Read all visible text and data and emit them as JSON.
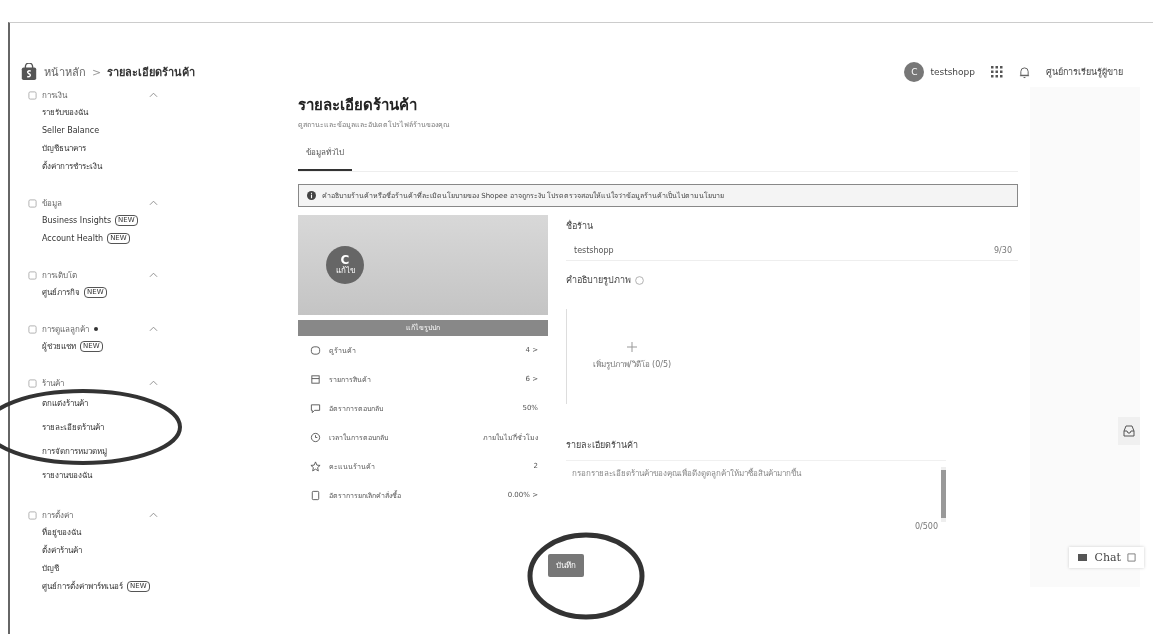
{
  "breadcrumb": {
    "home": "หน้าหลัก",
    "separator": ">",
    "current": "รายละเอียดร้านค้า"
  },
  "header": {
    "avatar_letter": "C",
    "username": "testshopp",
    "learning_link": "ศูนย์การเรียนรู้ผู้ขาย"
  },
  "sidebar": [
    {
      "title": "การเงิน",
      "expanded": true,
      "dot": false,
      "items": [
        {
          "label": "รายรับของฉัน"
        },
        {
          "label": "Seller Balance"
        },
        {
          "label": "บัญชีธนาคาร"
        },
        {
          "label": "ตั้งค่าการชำระเงิน"
        }
      ]
    },
    {
      "title": "ข้อมูล",
      "expanded": true,
      "dot": false,
      "items": [
        {
          "label": "Business Insights",
          "badge": "NEW"
        },
        {
          "label": "Account Health",
          "badge": "NEW"
        }
      ]
    },
    {
      "title": "การเติบโต",
      "expanded": true,
      "dot": false,
      "items": [
        {
          "label": "ศูนย์ภารกิจ",
          "badge": "NEW"
        }
      ]
    },
    {
      "title": "การดูแลลูกค้า",
      "expanded": true,
      "dot": true,
      "items": [
        {
          "label": "ผู้ช่วยแชท",
          "badge": "NEW"
        }
      ]
    },
    {
      "title": "ร้านค้า",
      "expanded": true,
      "dot": false,
      "circled": true,
      "items": [
        {
          "label": "ตกแต่งร้านค้า"
        },
        {
          "label": "รายละเอียดร้านค้า"
        },
        {
          "label": "การจัดการหมวดหมู่"
        },
        {
          "label": "รายงานของฉัน"
        }
      ]
    },
    {
      "title": "การตั้งค่า",
      "expanded": true,
      "dot": false,
      "items": [
        {
          "label": "ที่อยู่ของฉัน"
        },
        {
          "label": "ตั้งค่าร้านค้า"
        },
        {
          "label": "บัญชี"
        },
        {
          "label": "ศูนย์การตั้งค่าพาร์ทเนอร์",
          "badge": "NEW"
        }
      ]
    }
  ],
  "page": {
    "title": "รายละเอียดร้านค้า",
    "subtitle": "ดูสถานะและข้อมูลและอัปเดตโปรไฟล์ร้านของคุณ"
  },
  "tabs": [
    {
      "label": "ข้อมูลทั่วไป",
      "selected": true
    }
  ],
  "notice": "คำอธิบายร้านค้าหรือชื่อร้านค้าที่ละเมิดนโยบายของ Shopee อาจถูกระงับ โปรดตรวจสอบให้แน่ใจว่าข้อมูลร้านค้าเป็นไปตามนโยบาย",
  "cover": {
    "avatar_letter": "C",
    "avatar_label": "แก้ไข",
    "edit_button": "แก้ไขรูปปก"
  },
  "stats": [
    {
      "label": "ดูร้านค้า",
      "value": "4 >"
    },
    {
      "label": "รายการสินค้า",
      "value": "6 >"
    },
    {
      "label": "อัตราการตอบกลับ",
      "value": "50%"
    },
    {
      "label": "เวลาในการตอบกลับ",
      "value": "ภายในไม่กี่ชั่วโมง"
    },
    {
      "label": "คะแนนร้านค้า",
      "value": "2"
    },
    {
      "label": "อัตราการยกเลิกคำสั่งซื้อ",
      "value": "0.00% >"
    }
  ],
  "shop_name": {
    "label": "ชื่อร้าน",
    "value": "testshopp",
    "count": "9/30"
  },
  "images": {
    "label": "คำอธิบายรูปภาพ",
    "add_label": "เพิ่มรูปภาพ/วิดีโอ (0/5)"
  },
  "description": {
    "label": "รายละเอียดร้านค้า",
    "placeholder": "กรอกรายละเอียดร้านค้าของคุณเพื่อดึงดูดลูกค้าให้มาซื้อสินค้ามากขึ้น",
    "count": "0/500"
  },
  "save_button": {
    "label": "บันทึก",
    "circled": true
  },
  "chat": {
    "label": "Chat"
  }
}
